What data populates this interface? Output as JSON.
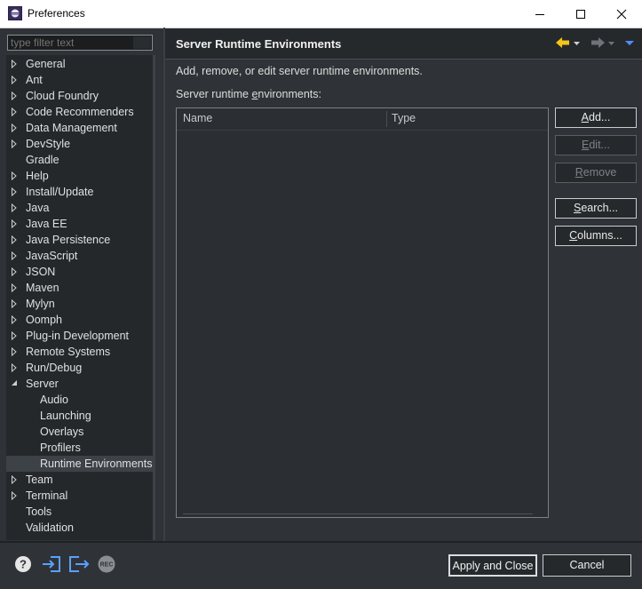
{
  "window": {
    "title": "Preferences"
  },
  "filter": {
    "placeholder": "type filter text"
  },
  "tree": {
    "items": [
      {
        "label": "General",
        "expandable": true,
        "level": 0
      },
      {
        "label": "Ant",
        "expandable": true,
        "level": 0
      },
      {
        "label": "Cloud Foundry",
        "expandable": true,
        "level": 0
      },
      {
        "label": "Code Recommenders",
        "expandable": true,
        "level": 0
      },
      {
        "label": "Data Management",
        "expandable": true,
        "level": 0
      },
      {
        "label": "DevStyle",
        "expandable": true,
        "level": 0
      },
      {
        "label": "Gradle",
        "expandable": false,
        "level": 0
      },
      {
        "label": "Help",
        "expandable": true,
        "level": 0
      },
      {
        "label": "Install/Update",
        "expandable": true,
        "level": 0
      },
      {
        "label": "Java",
        "expandable": true,
        "level": 0
      },
      {
        "label": "Java EE",
        "expandable": true,
        "level": 0
      },
      {
        "label": "Java Persistence",
        "expandable": true,
        "level": 0
      },
      {
        "label": "JavaScript",
        "expandable": true,
        "level": 0
      },
      {
        "label": "JSON",
        "expandable": true,
        "level": 0
      },
      {
        "label": "Maven",
        "expandable": true,
        "level": 0
      },
      {
        "label": "Mylyn",
        "expandable": true,
        "level": 0
      },
      {
        "label": "Oomph",
        "expandable": true,
        "level": 0
      },
      {
        "label": "Plug-in Development",
        "expandable": true,
        "level": 0
      },
      {
        "label": "Remote Systems",
        "expandable": true,
        "level": 0
      },
      {
        "label": "Run/Debug",
        "expandable": true,
        "level": 0
      },
      {
        "label": "Server",
        "expandable": true,
        "expanded": true,
        "level": 0
      },
      {
        "label": "Audio",
        "expandable": false,
        "level": 1
      },
      {
        "label": "Launching",
        "expandable": false,
        "level": 1
      },
      {
        "label": "Overlays",
        "expandable": false,
        "level": 1
      },
      {
        "label": "Profilers",
        "expandable": false,
        "level": 1
      },
      {
        "label": "Runtime Environments",
        "expandable": false,
        "level": 1,
        "selected": true
      },
      {
        "label": "Team",
        "expandable": true,
        "level": 0
      },
      {
        "label": "Terminal",
        "expandable": true,
        "level": 0
      },
      {
        "label": "Tools",
        "expandable": false,
        "level": 0
      },
      {
        "label": "Validation",
        "expandable": false,
        "level": 0
      }
    ]
  },
  "page": {
    "title": "Server Runtime Environments",
    "description": "Add, remove, or edit server runtime environments.",
    "list_label_pre": "Server runtime ",
    "list_label_mn": "e",
    "list_label_post": "nvironments:",
    "columns": [
      "Name",
      "Type"
    ]
  },
  "buttons": {
    "add": {
      "mn": "A",
      "rest": "dd..."
    },
    "edit": {
      "mn": "E",
      "rest": "dit..."
    },
    "remove": {
      "mn": "R",
      "rest": "emove"
    },
    "search": {
      "mn": "S",
      "rest": "earch..."
    },
    "columns": {
      "mn": "C",
      "rest": "olumns..."
    }
  },
  "footer": {
    "apply_close": "Apply and Close",
    "cancel": "Cancel",
    "rec_label": "REC"
  },
  "colors": {
    "accent_yellow": "#f5c518",
    "accent_blue": "#4f8ff7",
    "background": "#2f3337"
  },
  "icons": [
    "eclipse-app-icon",
    "minimize-icon",
    "maximize-icon",
    "close-icon",
    "back-arrow-icon",
    "forward-arrow-icon",
    "view-menu-icon",
    "help-icon",
    "import-icon",
    "export-icon",
    "record-icon"
  ]
}
